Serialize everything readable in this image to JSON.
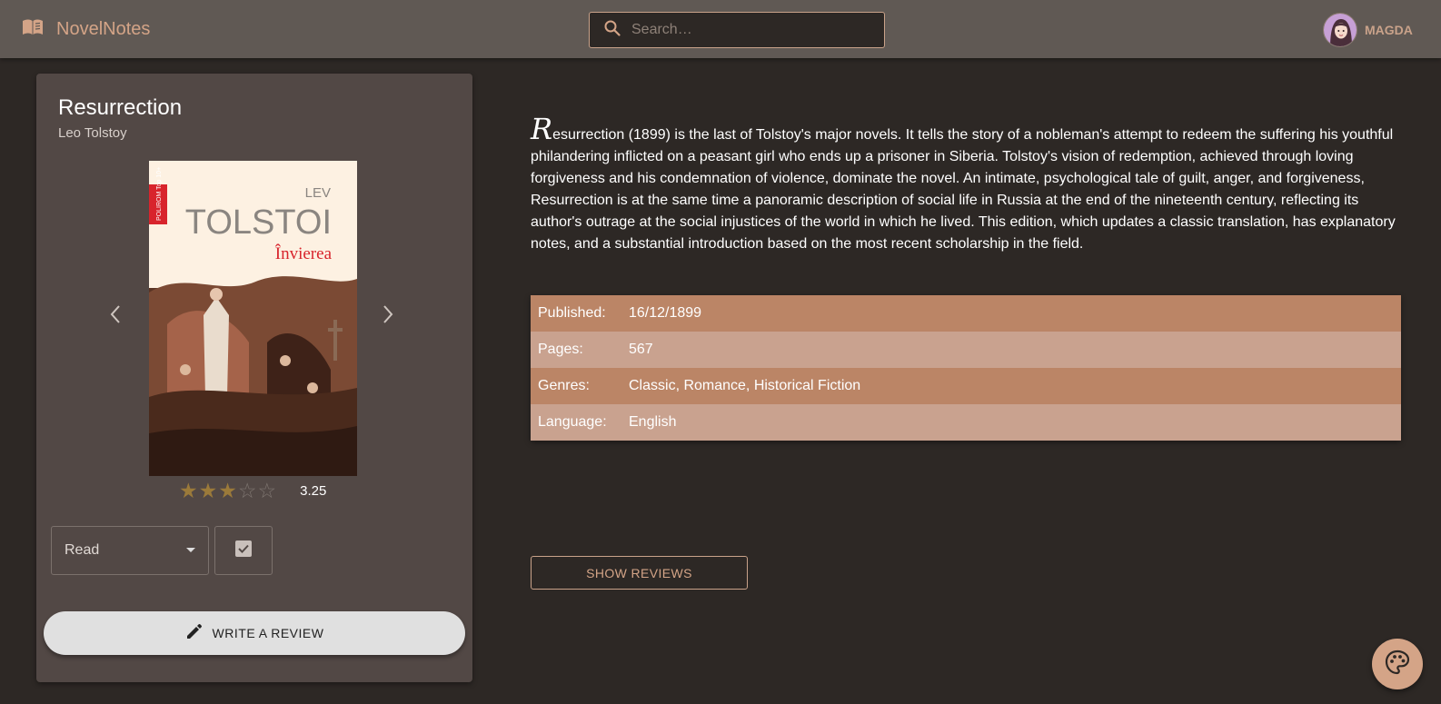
{
  "header": {
    "brand": "NovelNotes",
    "search_placeholder": "Search…",
    "user_name": "MAGDA"
  },
  "book": {
    "title": "Resurrection",
    "author": "Leo Tolstoy",
    "cover_text": {
      "publisher_badge": "POLIROM Top 10+",
      "author_first": "LEV",
      "author_last": "TOLSTOI",
      "title": "Învierea"
    },
    "rating": 3.25,
    "rating_label": "3.25",
    "stars": {
      "filled": 3,
      "total": 5
    },
    "status": "Read",
    "write_review_label": "WRITE A REVIEW"
  },
  "description": {
    "dropcap": "R",
    "text": "esurrection (1899) is the last of Tolstoy's major novels. It tells the story of a nobleman's attempt to redeem the suffering his youthful philandering inflicted on a peasant girl who ends up a prisoner in Siberia. Tolstoy's vision of redemption, achieved through loving forgiveness and his condemnation of violence, dominate the novel. An intimate, psychological tale of guilt, anger, and forgiveness, Resurrection is at the same time a panoramic description of social life in Russia at the end of the nineteenth century, reflecting its author's outrage at the social injustices of the world in which he lived. This edition, which updates a classic translation, has explanatory notes, and a substantial introduction based on the most recent scholarship in the field."
  },
  "details": [
    {
      "label": "Published:",
      "value": "16/12/1899"
    },
    {
      "label": "Pages:",
      "value": "567"
    },
    {
      "label": "Genres:",
      "value": "Classic, Romance, Historical Fiction"
    },
    {
      "label": "Language:",
      "value": "English"
    }
  ],
  "show_reviews_label": "SHOW REVIEWS",
  "colors": {
    "accent": "#d4a487",
    "background": "#2d2825",
    "appbar": "#605954",
    "card": "#524845",
    "row_odd": "#bb8566",
    "row_even": "#c9a28f"
  },
  "icons": {
    "brand": "open-book-icon",
    "search": "search-icon",
    "prev": "chevron-left-icon",
    "next": "chevron-right-icon",
    "check": "checkbox-checked-icon",
    "write": "pencil-icon",
    "theme": "palette-icon"
  }
}
